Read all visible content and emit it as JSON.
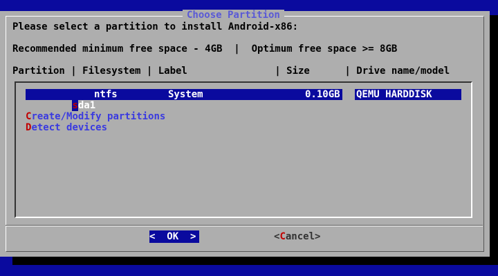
{
  "dialog": {
    "title": "Choose Partition",
    "prompt": "Please select a partition to install Android-x86:",
    "space_info": "Recommended minimum free space - 4GB  |  Optimum free space >= 8GB",
    "header": "Partition | Filesystem | Label               | Size      | Drive name/model"
  },
  "partitions": [
    {
      "hotkey": "s",
      "name_rest": "da1",
      "filesystem": "ntfs",
      "label": "System",
      "size": "0.10GB",
      "drive": "QEMU HARDDISK"
    }
  ],
  "options": [
    {
      "hotkey": "C",
      "rest": "reate/Modify partitions"
    },
    {
      "hotkey": "D",
      "rest": "etect devices"
    }
  ],
  "buttons": {
    "ok_label": "<  OK  >",
    "cancel_open": "<",
    "cancel_hotkey": "C",
    "cancel_rest": "ancel>"
  },
  "colors": {
    "background": "#0a0a9e",
    "dialog": "#aeaeae",
    "title": "#5a5ad6",
    "hotkey": "#c00000",
    "option_text": "#3a3ae0"
  }
}
